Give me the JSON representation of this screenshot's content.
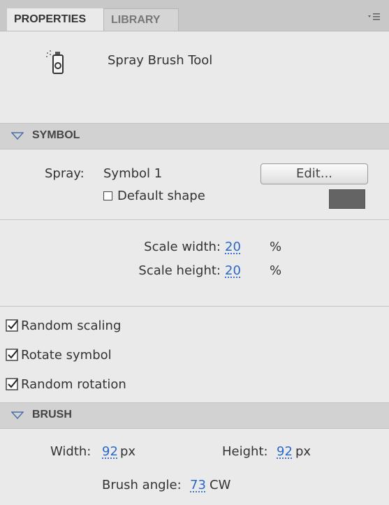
{
  "tabs": {
    "properties": "PROPERTIES",
    "library": "LIBRARY"
  },
  "tool": {
    "name": "Spray Brush Tool",
    "icon": "spray-can-icon"
  },
  "symbol_section": {
    "title": "SYMBOL",
    "spray_label": "Spray:",
    "spray_value": "Symbol 1",
    "edit_button": "Edit...",
    "default_shape_label": "Default shape",
    "default_shape_checked": false,
    "swatch_color": "#646464",
    "scale_width_label": "Scale width:",
    "scale_width_value": "20",
    "scale_height_label": "Scale height:",
    "scale_height_value": "20",
    "percent": "%"
  },
  "options": [
    {
      "label": "Random scaling",
      "checked": true
    },
    {
      "label": "Rotate symbol",
      "checked": true
    },
    {
      "label": "Random rotation",
      "checked": true
    }
  ],
  "brush_section": {
    "title": "BRUSH",
    "width_label": "Width:",
    "width_value": "92",
    "height_label": "Height:",
    "height_value": "92",
    "px": "px",
    "angle_label": "Brush angle:",
    "angle_value": "73",
    "angle_unit": "CW"
  }
}
